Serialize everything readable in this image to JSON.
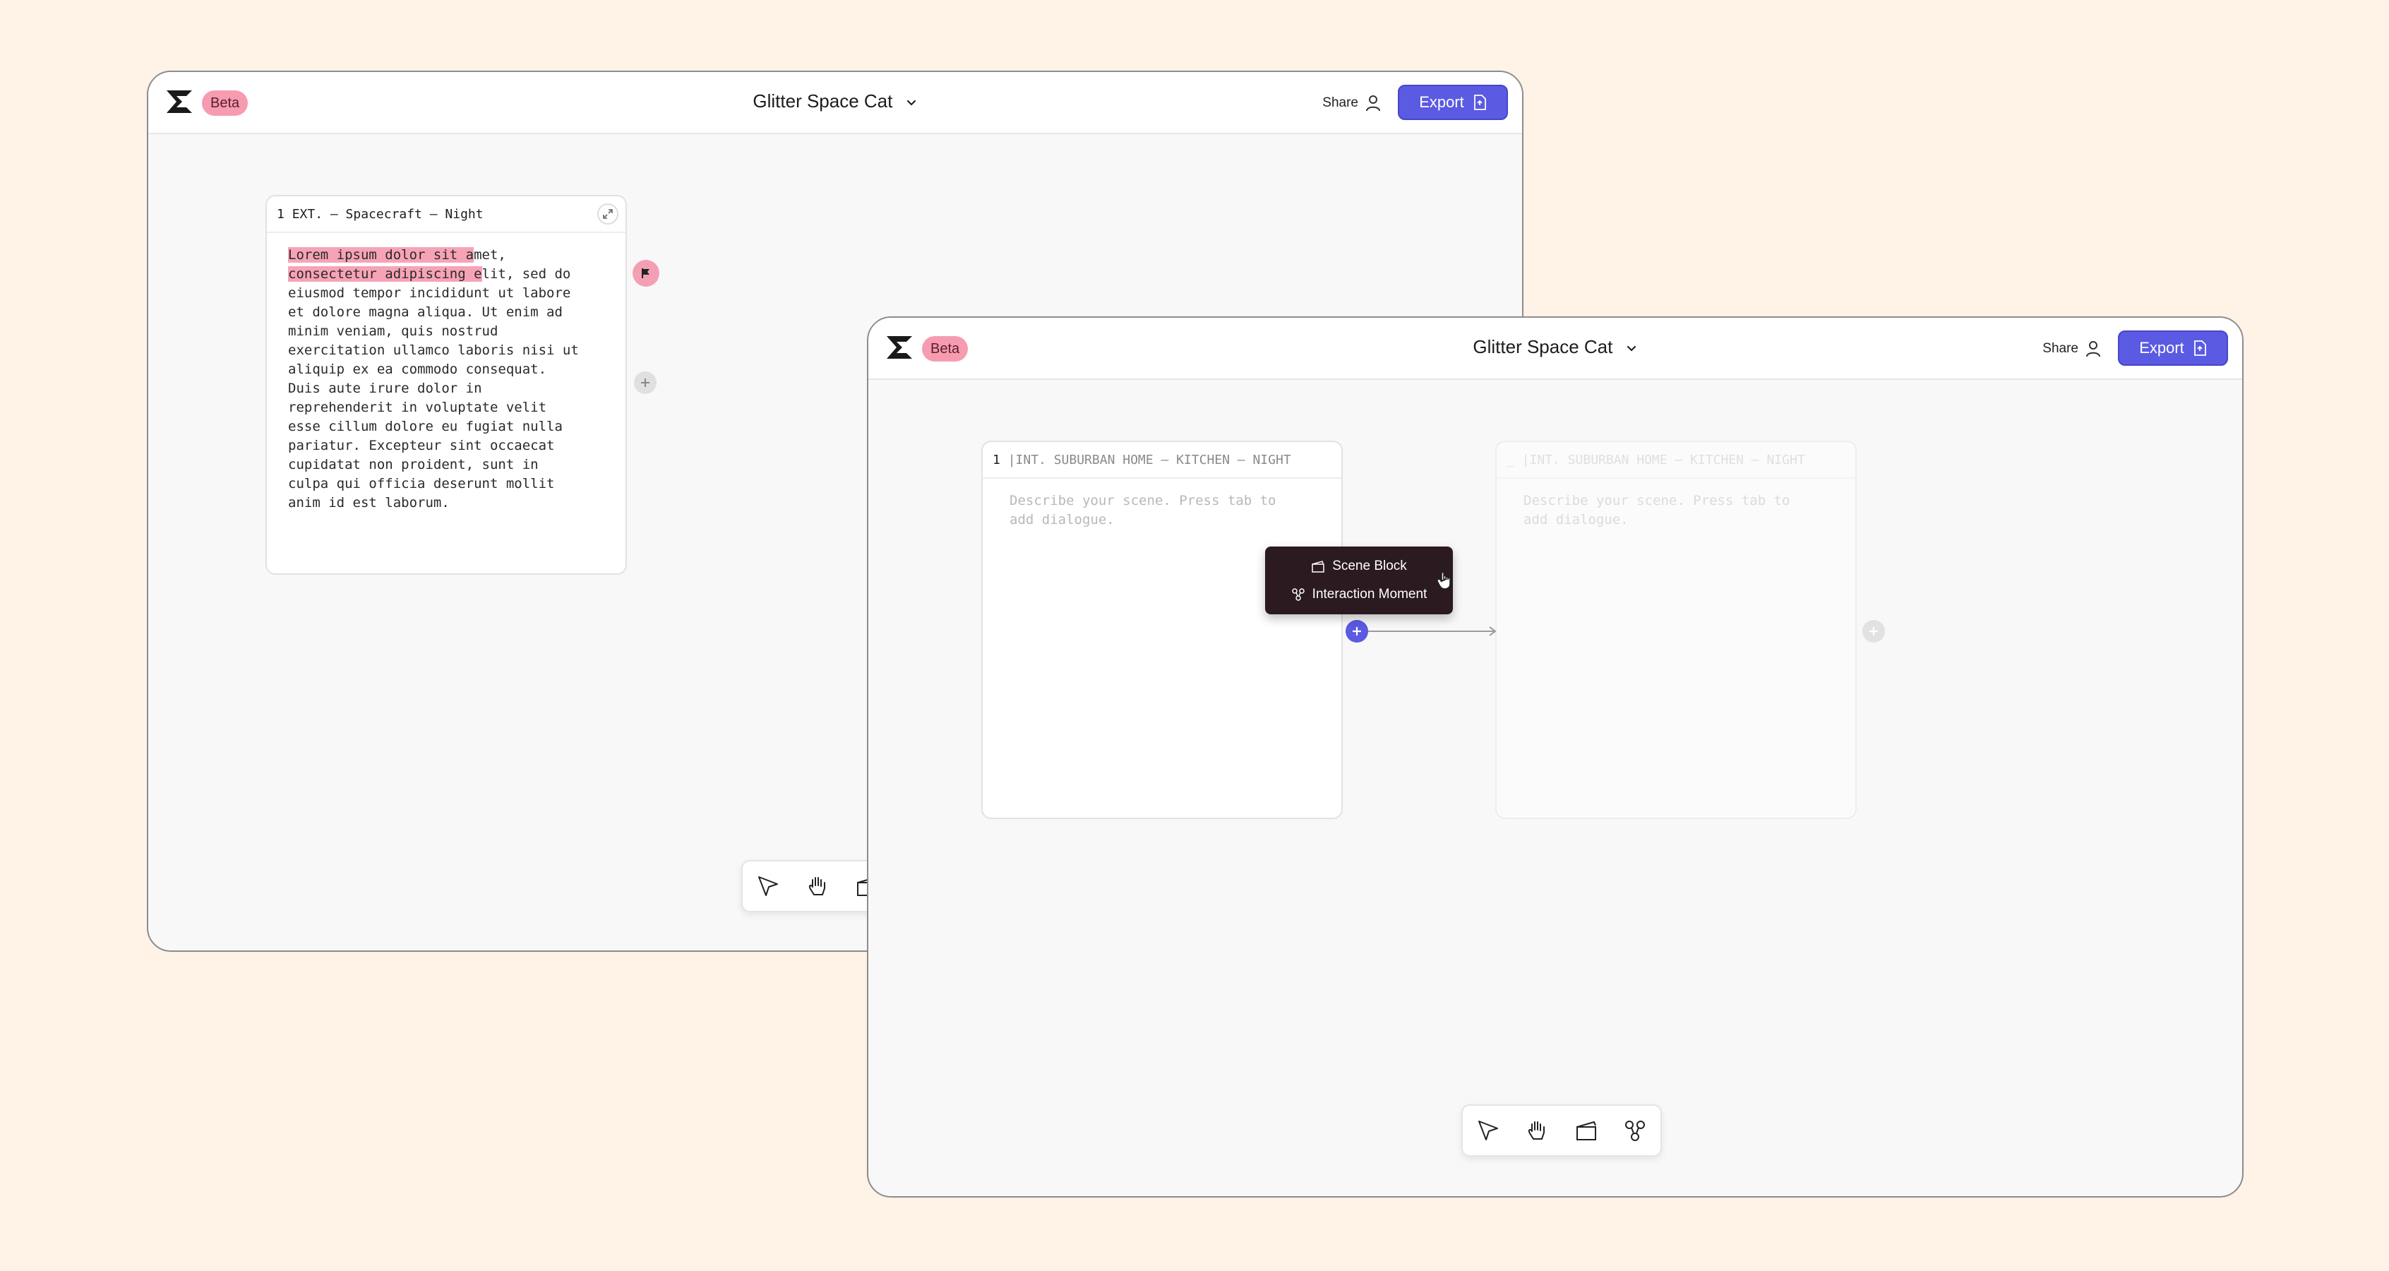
{
  "app": {
    "beta_badge": "Beta",
    "project_title": "Glitter Space Cat",
    "share_label": "Share",
    "export_label": "Export"
  },
  "window_back": {
    "scene_card": {
      "number": "1",
      "heading": "EXT. – Spacecraft – Night",
      "text_highlight_1": "Lorem ipsum dolor sit a",
      "text_after_1": "met,",
      "text_highlight_2": "consectetur adipiscing e",
      "text_after_2": "lit, sed do",
      "text_rest": "eiusmod tempor incididunt ut labore\net dolore magna aliqua. Ut enim ad\nminim veniam, quis nostrud\nexercitation ullamco laboris nisi ut\naliquip ex ea commodo consequat.\nDuis aute irure dolor in\nreprehenderit in voluptate velit\nesse cillum dolore eu fugiat nulla\npariatur. Excepteur sint occaecat\ncupidatat non proident, sunt in\nculpa qui officia deserunt mollit\nanim id est laborum."
    }
  },
  "window_front": {
    "scene_card": {
      "number": "1",
      "heading": "|INT. SUBURBAN HOME – KITCHEN  – NIGHT",
      "placeholder": "Describe your scene. Press tab to\nadd dialogue."
    },
    "ghost_card": {
      "number": "_",
      "heading": "|INT. SUBURBAN HOME – KITCHEN  – NIGHT",
      "placeholder": "Describe your scene. Press tab to\nadd dialogue."
    },
    "add_menu": {
      "items": [
        "Scene Block",
        "Interaction Moment"
      ]
    }
  },
  "colors": {
    "accent": "#5B5AE2",
    "beta_pink": "#F79BB0",
    "highlight_pink": "#F7A3B6",
    "menu_bg": "#2B1A20",
    "page_bg": "#FFF2E6"
  },
  "icons": [
    "logo-icon",
    "chevron-down-icon",
    "user-icon",
    "export-file-icon",
    "expand-icon",
    "flag-icon",
    "plus-icon",
    "cursor-icon",
    "hand-icon",
    "clapperboard-icon",
    "interaction-icon"
  ]
}
